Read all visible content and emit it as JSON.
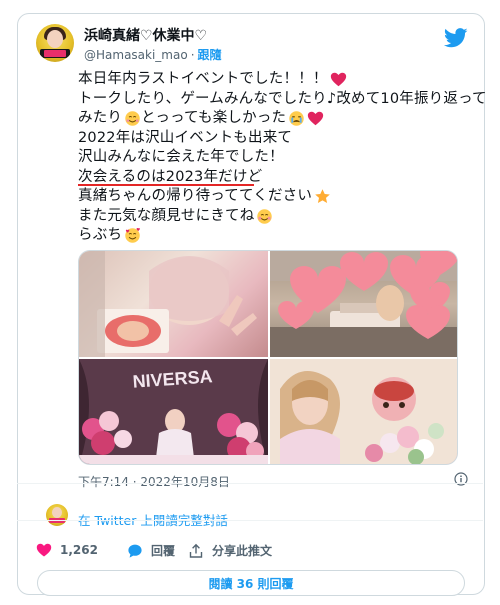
{
  "author": {
    "display_name": "浜崎真緒♡休業中♡",
    "handle": "@Hamasaki_mao",
    "separator": "·",
    "follow_label": "跟隨"
  },
  "tweet": {
    "lines": [
      "本日年内ラストイベントでした！！！",
      "トークしたり、ゲームみんなでしたり♪改めて10年振り返って",
      "みたり",
      "とっっても楽しかった",
      "2022年は沢山イベントも出来て",
      "沢山みんなに会えた年でした！",
      "次会えるのは2023年だけど",
      "真緒ちゃんの帰り待っててください",
      "また元気な顔見せにきてね",
      "らぶち"
    ],
    "timestamp": "下午7:14 · 2022年10月8日"
  },
  "media": {
    "photo_banner_text": "NIVERSA"
  },
  "conversation": {
    "link_text": "在 Twitter 上閱讀完整對話"
  },
  "actions": {
    "like_count": "1,262",
    "reply_label": "回覆",
    "share_label": "分享此推文"
  },
  "footer": {
    "read_replies_label": "閱讀 36 則回覆"
  },
  "colors": {
    "brand_blue": "#1d9bf0",
    "like_red": "#f91880",
    "text_primary": "#0f1419",
    "text_secondary": "#536471",
    "underline_red": "#e32626"
  }
}
